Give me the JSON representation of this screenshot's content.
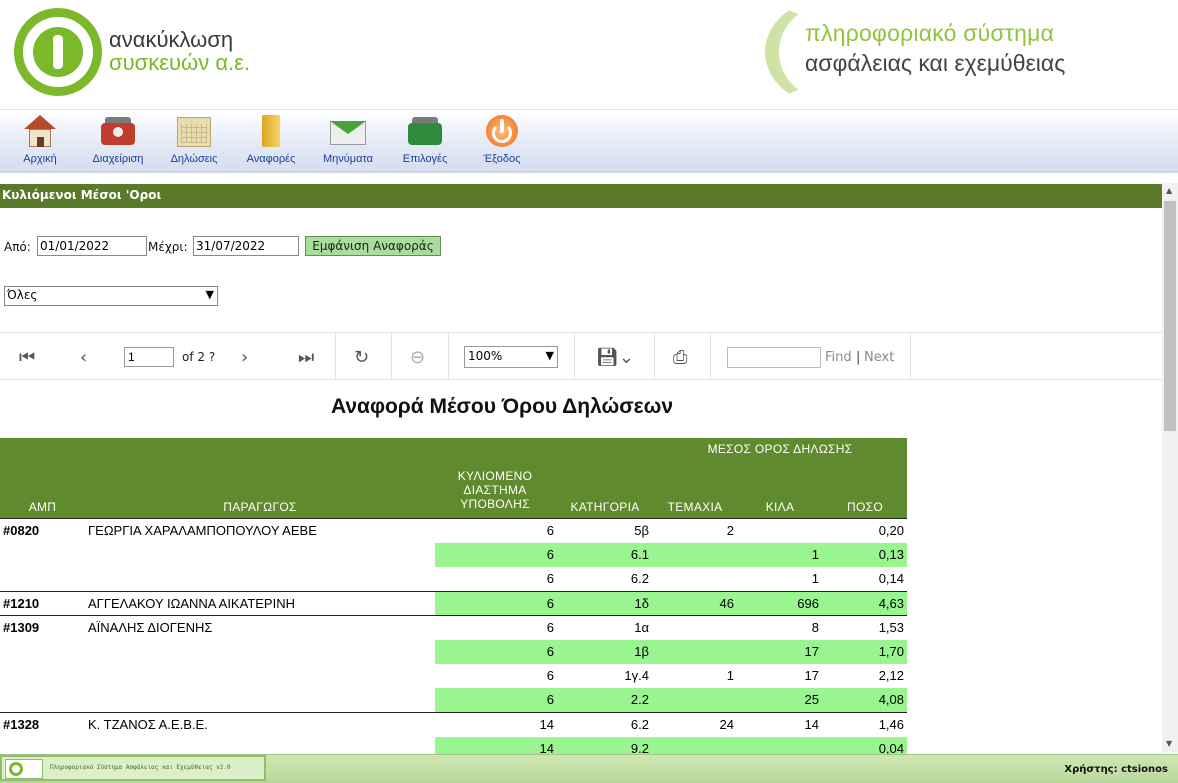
{
  "header": {
    "logo_line1": "ανακύκλωση",
    "logo_line2": "συσκευών α.ε.",
    "system_line1": "πληροφοριακό σύστημα",
    "system_line2": "ασφάλειας και εχεμύθειας"
  },
  "nav": [
    {
      "label": "Αρχική",
      "icon": "home-icon"
    },
    {
      "label": "Διαχείριση",
      "icon": "admin-icon"
    },
    {
      "label": "Δηλώσεις",
      "icon": "calendar-icon"
    },
    {
      "label": "Αναφορές",
      "icon": "folder-icon"
    },
    {
      "label": "Μηνύματα",
      "icon": "mail-icon"
    },
    {
      "label": "Επιλογές",
      "icon": "options-icon"
    },
    {
      "label": "Έξοδος",
      "icon": "power-icon"
    }
  ],
  "section_title": "Κυλιόμενοι Μέσοι 'Οροι",
  "filters": {
    "from_label": "Από:",
    "from_value": "01/01/2022",
    "to_label": "Μέχρι:",
    "to_value": "31/07/2022",
    "show_button": "Εμφάνιση Αναφοράς",
    "category_value": "Όλες"
  },
  "toolbar": {
    "page_value": "1",
    "of_text": "of 2 ?",
    "zoom_value": "100%",
    "find_label": "Find",
    "separator": "|",
    "next_label": "Next"
  },
  "report": {
    "title": "Αναφορά Μέσου Όρου Δηλώσεων",
    "group_header": "ΜΕΣΟΣ ΟΡΟΣ ΔΗΛΩΣΗΣ",
    "columns": {
      "amp": "ΑΜΠ",
      "producer": "ΠΑΡΑΓΩΓΟΣ",
      "interval_l1": "ΚΥΛΙΟΜΕΝΟ",
      "interval_l2": "ΔΙΑΣΤΗΜΑ",
      "interval_l3": "ΥΠΟΒΟΛΗΣ",
      "category": "ΚΑΤΗΓΟΡΙΑ",
      "pieces": "ΤΕΜΑΧΙΑ",
      "kilos": "ΚΙΛΑ",
      "amount": "ΠΟΣΟ"
    },
    "rows": [
      {
        "amp": "#0820",
        "producer": "ΓΕΩΡΓΙΑ ΧΑΡΑΛΑΜΠΟΠΟΥΛΟΥ ΑΕΒΕ",
        "interval": "6",
        "category": "5β",
        "pieces": "2",
        "kilos": "",
        "amount": "0,20"
      },
      {
        "amp": "",
        "producer": "",
        "interval": "6",
        "category": "6.1",
        "pieces": "",
        "kilos": "1",
        "amount": "0,13"
      },
      {
        "amp": "",
        "producer": "",
        "interval": "6",
        "category": "6.2",
        "pieces": "",
        "kilos": "1",
        "amount": "0,14"
      },
      {
        "amp": "#1210",
        "producer": "ΑΓΓΕΛΑΚΟΥ ΙΩΑΝΝΑ ΑΙΚΑΤΕΡΙΝΗ",
        "interval": "6",
        "category": "1δ",
        "pieces": "46",
        "kilos": "696",
        "amount": "4,63"
      },
      {
        "amp": "#1309",
        "producer": "ΑΪΝΑΛΗΣ ΔΙΟΓΕΝΗΣ",
        "interval": "6",
        "category": "1α",
        "pieces": "",
        "kilos": "8",
        "amount": "1,53"
      },
      {
        "amp": "",
        "producer": "",
        "interval": "6",
        "category": "1β",
        "pieces": "",
        "kilos": "17",
        "amount": "1,70"
      },
      {
        "amp": "",
        "producer": "",
        "interval": "6",
        "category": "1γ.4",
        "pieces": "1",
        "kilos": "17",
        "amount": "2,12"
      },
      {
        "amp": "",
        "producer": "",
        "interval": "6",
        "category": "2.2",
        "pieces": "",
        "kilos": "25",
        "amount": "4,08"
      },
      {
        "amp": "#1328",
        "producer": "Κ. ΤΖΑΝΟΣ Α.Ε.Β.Ε.",
        "interval": "14",
        "category": "6.2",
        "pieces": "24",
        "kilos": "14",
        "amount": "1,46"
      },
      {
        "amp": "",
        "producer": "",
        "interval": "14",
        "category": "9.2",
        "pieces": "",
        "kilos": "",
        "amount": "0,04"
      }
    ]
  },
  "footer": {
    "system_text": "Πληροφοριακό Σύστημα Ασφάλειας και Εχεμύθειας v2.0",
    "user_text": "Χρήστης: ctsionos"
  },
  "colors": {
    "brand_green": "#7bb82a",
    "section_bar": "#5a7a2a",
    "table_header": "#5f8a2e",
    "row_highlight": "#98f58f",
    "nav_text": "#1a3f9a"
  }
}
